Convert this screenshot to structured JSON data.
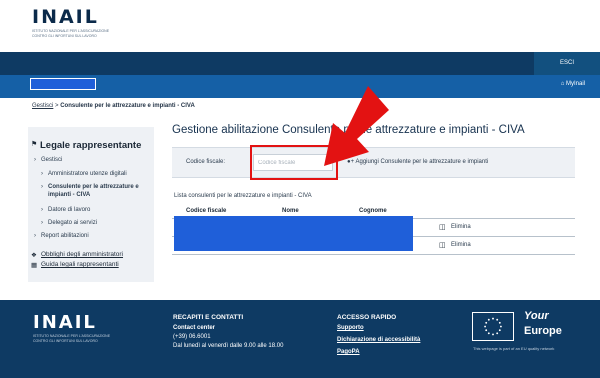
{
  "header": {
    "logo": "INAIL",
    "logo_sub": "Istituto nazionale per l'assicurazione contro gli infortuni sul lavoro"
  },
  "topbar": {
    "logout": "ESCI",
    "myinail": "MyInail"
  },
  "breadcrumb": {
    "home": "Gestisci",
    "separator": ">",
    "current": "Consulente per le attrezzature e impianti - CIVA"
  },
  "sidebar": {
    "title": "Legale rappresentante",
    "items": [
      {
        "label": "Gestisci",
        "level": 1
      },
      {
        "label": "Amministratore utenze digitali",
        "level": 2
      },
      {
        "label": "Consulente per le attrezzature e impianti - CIVA",
        "level": 2,
        "current": true
      },
      {
        "label": "Datore di lavoro",
        "level": 2
      },
      {
        "label": "Delegato ai servizi",
        "level": 2
      },
      {
        "label": "Report abilitazioni",
        "level": 1
      }
    ],
    "links": [
      "Obblighi degli amministratori",
      "Guida legali rappresentanti"
    ]
  },
  "main": {
    "title": "Gestione abilitazione Consulente per le attrezzature e impianti - CIVA",
    "filter": {
      "label": "Codice fiscale:",
      "placeholder": "Codice fiscale",
      "value": "",
      "add_label": "Aggiungi Consulente per le attrezzature e impianti"
    },
    "list_title": "Lista consulenti per le attrezzature e impianti - CIVA",
    "columns": [
      "Codice fiscale",
      "Nome",
      "Cognome"
    ],
    "rows": [
      {
        "action": "Elimina"
      },
      {
        "action": "Elimina"
      }
    ]
  },
  "footer": {
    "logo": "INAIL",
    "logo_sub": "Istituto nazionale per l'assicurazione contro gli infortuni sul lavoro",
    "contacts": {
      "heading": "RECAPITI E CONTATTI",
      "subheading": "Contact center",
      "phone": "(+39) 06.6001",
      "hours": "Dal lunedì al venerdì dalle 9.00 alle 18.00"
    },
    "quick": {
      "heading": "ACCESSO RAPIDO",
      "links": [
        "Supporto",
        "Dichiarazione di accessibilità",
        "PagoPA"
      ]
    },
    "eu": {
      "line1": "Your",
      "line2": "Europe",
      "note": "This webpage is part of an EU quality network"
    }
  },
  "colors": {
    "primary_dark": "#0e3a63",
    "primary": "#1560a6",
    "highlight": "#e31212",
    "redaction": "#1f5fd9"
  }
}
